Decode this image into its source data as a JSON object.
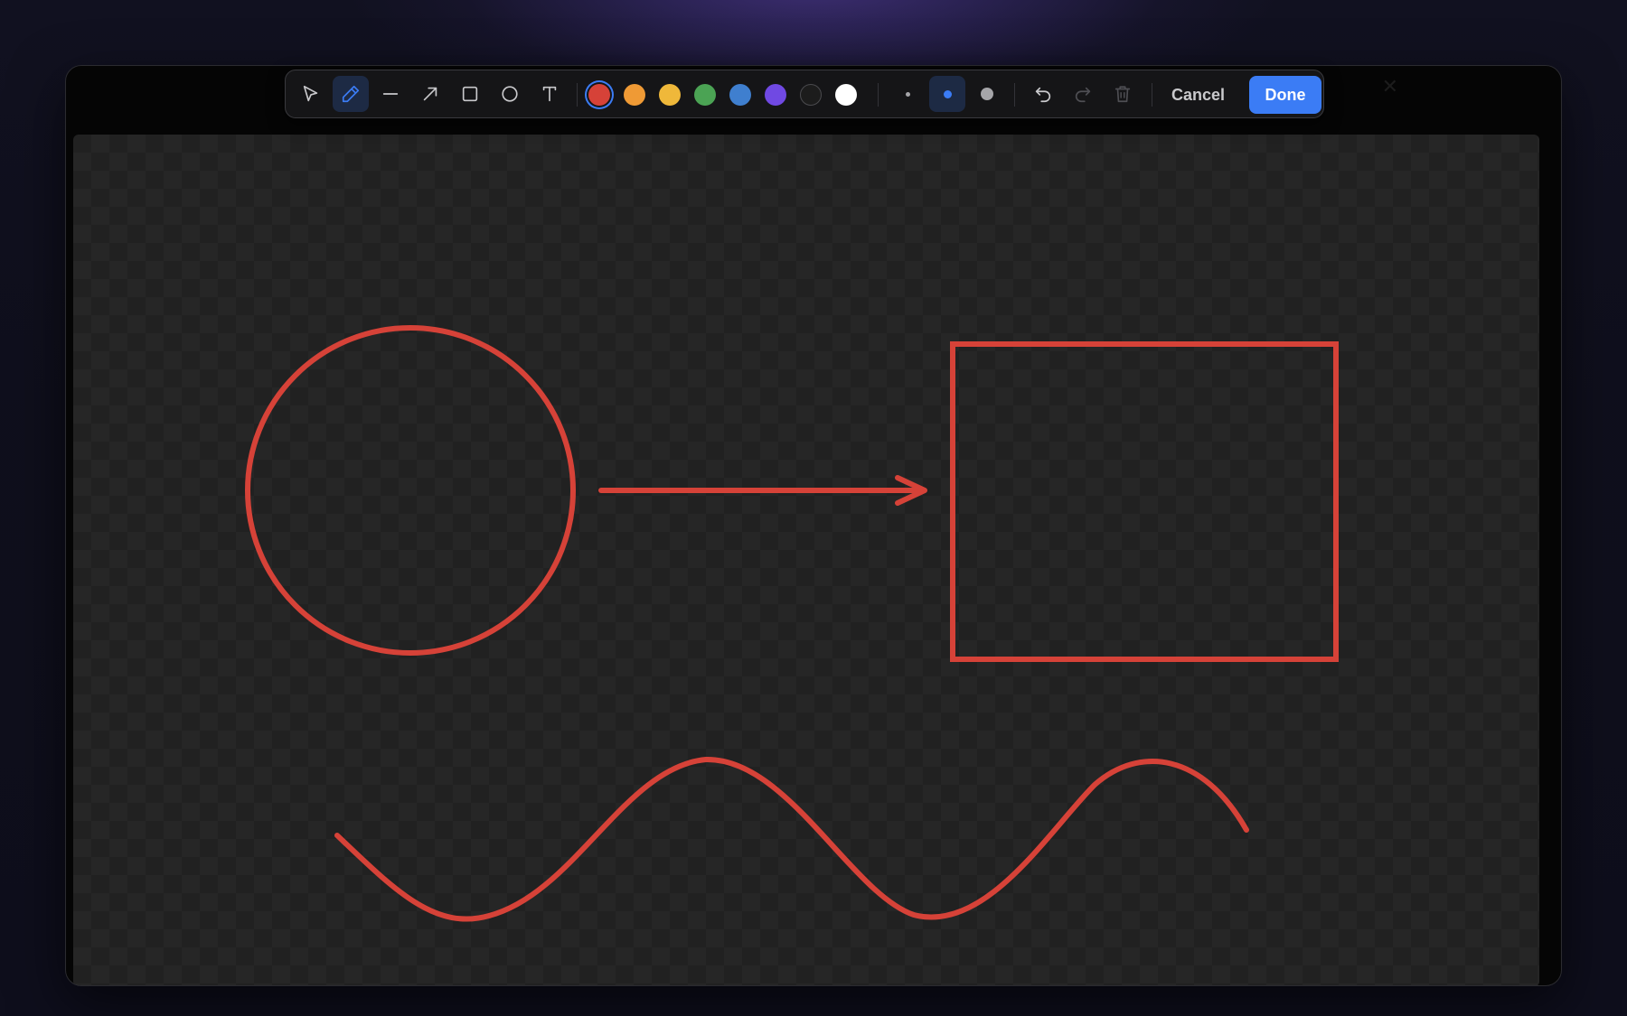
{
  "window": {
    "title": "",
    "close_icon": "close-icon"
  },
  "toolbar": {
    "tools": [
      {
        "name": "select",
        "icon": "cursor-arrow-icon",
        "active": false
      },
      {
        "name": "pen",
        "icon": "pen-icon",
        "active": true
      },
      {
        "name": "line",
        "icon": "line-icon",
        "active": false
      },
      {
        "name": "arrow",
        "icon": "arrow-icon",
        "active": false
      },
      {
        "name": "rectangle",
        "icon": "rectangle-icon",
        "active": false
      },
      {
        "name": "ellipse",
        "icon": "circle-icon",
        "active": false
      },
      {
        "name": "text",
        "icon": "text-icon",
        "active": false
      }
    ],
    "colors": [
      {
        "name": "red",
        "hex": "#d64238",
        "selected": true
      },
      {
        "name": "orange",
        "hex": "#ef9a35",
        "selected": false
      },
      {
        "name": "yellow",
        "hex": "#efb83a",
        "selected": false
      },
      {
        "name": "green",
        "hex": "#4ba354",
        "selected": false
      },
      {
        "name": "blue",
        "hex": "#3f7fcf",
        "selected": false
      },
      {
        "name": "purple",
        "hex": "#7049e3",
        "selected": false
      },
      {
        "name": "black",
        "hex": "#1c1c1c",
        "selected": false
      },
      {
        "name": "white",
        "hex": "#ffffff",
        "selected": false
      }
    ],
    "stroke_sizes": [
      {
        "name": "small",
        "selected": false
      },
      {
        "name": "medium",
        "selected": true
      },
      {
        "name": "large",
        "selected": false
      }
    ],
    "actions": {
      "undo_icon": "undo-icon",
      "redo_icon": "redo-icon",
      "delete_icon": "trash-icon"
    },
    "cancel_label": "Cancel",
    "done_label": "Done",
    "accent_color": "#3b7cf5"
  },
  "canvas": {
    "background": "transparent-checkerboard",
    "stroke_color": "#d64238",
    "shapes": [
      "circle",
      "arrow",
      "rectangle",
      "freehand-wave"
    ]
  }
}
